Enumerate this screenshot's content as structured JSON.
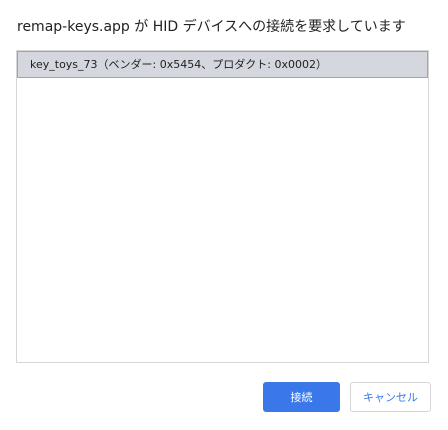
{
  "dialog": {
    "title": "remap-keys.app が HID デバイスへの接続を要求しています"
  },
  "devices": [
    {
      "label": "key_toys_73（ベンダー: 0x5454、プロダクト: 0x0002）",
      "selected": true
    }
  ],
  "buttons": {
    "connect_label": "接続",
    "cancel_label": "キャンセル"
  },
  "colors": {
    "accent": "#3a78ea",
    "selected_row": "#d4d8de",
    "border": "#d6d6d6"
  }
}
